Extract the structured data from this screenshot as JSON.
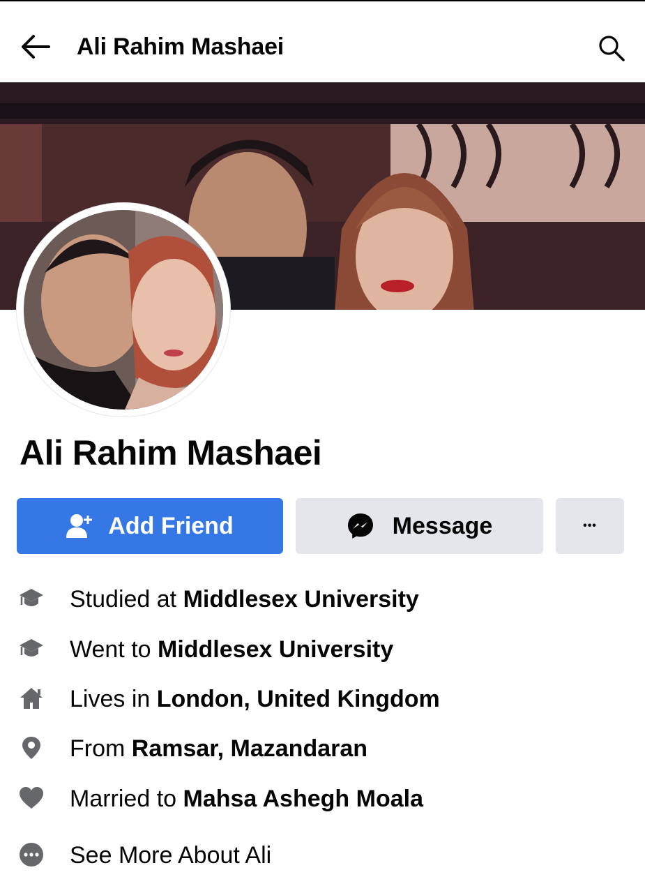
{
  "header": {
    "title": "Ali Rahim Mashaei"
  },
  "profile": {
    "name": "Ali Rahim Mashaei"
  },
  "actions": {
    "add_friend": "Add Friend",
    "message": "Message",
    "more": "•••"
  },
  "accent_color": "#3578e5",
  "icon_color": "#65676b",
  "info": [
    {
      "icon": "graduation-cap-icon",
      "prefix": "Studied at ",
      "value": "Middlesex University"
    },
    {
      "icon": "graduation-cap-icon",
      "prefix": "Went to ",
      "value": "Middlesex University"
    },
    {
      "icon": "home-icon",
      "prefix": "Lives in ",
      "value": "London, United Kingdom"
    },
    {
      "icon": "location-pin-icon",
      "prefix": "From ",
      "value": "Ramsar, Mazandaran"
    },
    {
      "icon": "heart-icon",
      "prefix": "Married to ",
      "value": "Mahsa Ashegh Moala"
    },
    {
      "icon": "more-circle-icon",
      "prefix": "See More About Ali",
      "value": ""
    }
  ]
}
